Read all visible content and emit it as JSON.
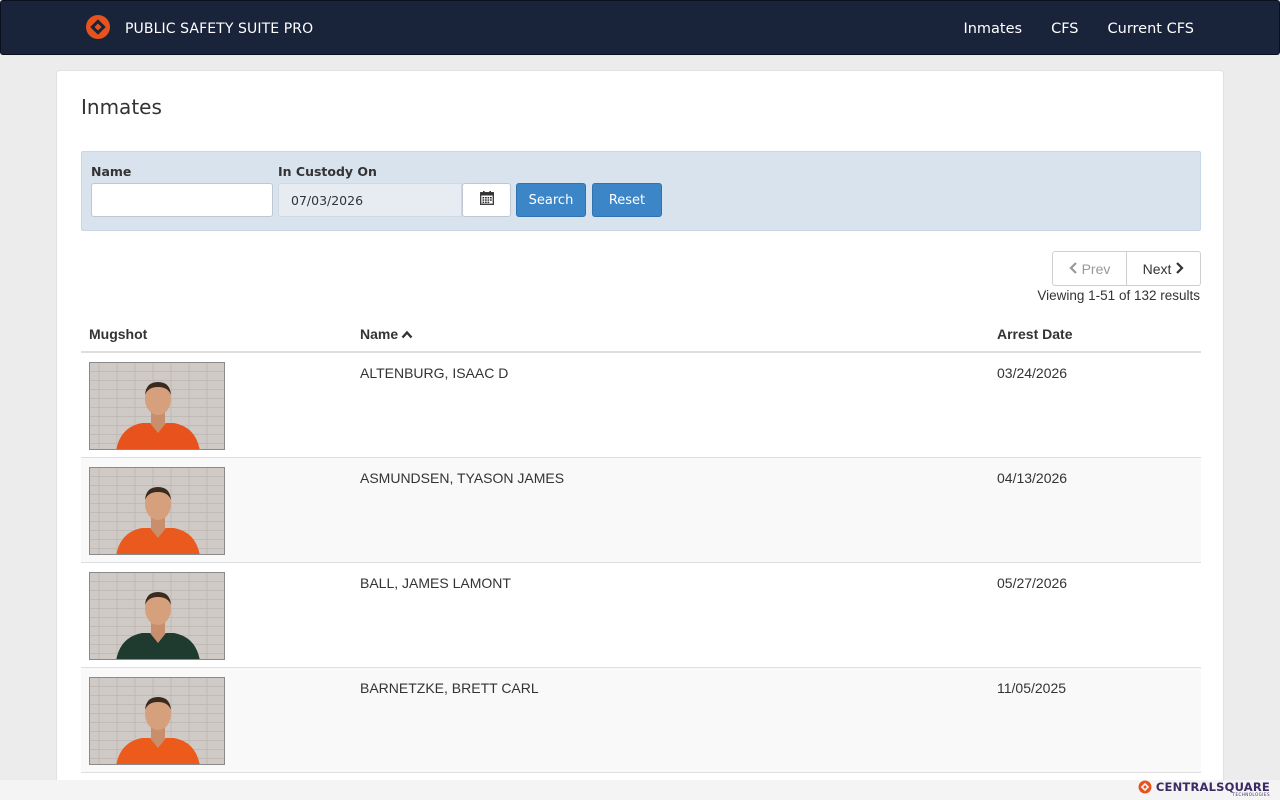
{
  "navbar": {
    "brand": "PUBLIC SAFETY SUITE PRO",
    "links": [
      "Inmates",
      "CFS",
      "Current CFS"
    ]
  },
  "page": {
    "title": "Inmates"
  },
  "filters": {
    "name_label": "Name",
    "name_value": "",
    "custody_label": "In Custody On",
    "custody_value": "07/03/2026",
    "search_label": "Search",
    "reset_label": "Reset"
  },
  "pager": {
    "prev_label": "Prev",
    "next_label": "Next",
    "results_text": "Viewing 1-51 of 132 results"
  },
  "table": {
    "columns": [
      "Mugshot",
      "Name",
      "Arrest Date"
    ],
    "rows": [
      {
        "name": "ALTENBURG, ISAAC D",
        "arrest_date": "03/24/2026",
        "uniform_color": "#e8531d"
      },
      {
        "name": "ASMUNDSEN, TYASON JAMES",
        "arrest_date": "04/13/2026",
        "uniform_color": "#ea5a1f"
      },
      {
        "name": "BALL, JAMES LAMONT",
        "arrest_date": "05/27/2026",
        "uniform_color": "#1f3a2e"
      },
      {
        "name": "BARNETZKE, BRETT CARL",
        "arrest_date": "11/05/2025",
        "uniform_color": "#ec5a1c"
      }
    ]
  },
  "footer": {
    "brand": "CENTRALSQUARE",
    "sub": "TECHNOLOGIES"
  },
  "colors": {
    "navbar_bg": "#19233a",
    "accent_orange": "#e8531d",
    "button_blue": "#3c86c8",
    "filter_bg": "#d8e3ee"
  }
}
